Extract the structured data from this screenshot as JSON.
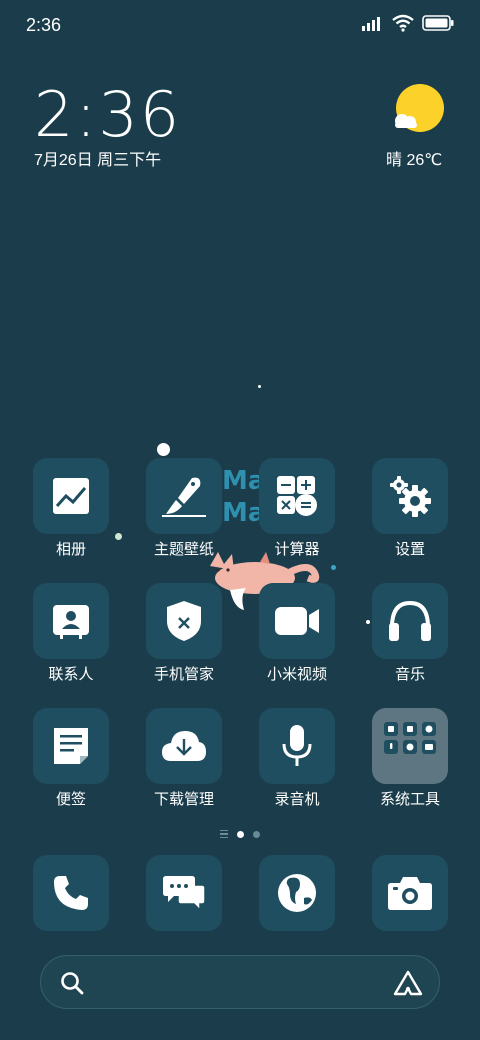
{
  "status_bar": {
    "time": "2:36",
    "icons": [
      "signal-icon",
      "wifi-icon",
      "battery-icon"
    ]
  },
  "clock_widget": {
    "time": "2:36",
    "date": "7月26日 周三下午"
  },
  "weather_widget": {
    "text": "晴 26℃",
    "icon": "sunny-icon",
    "sun_color": "#fcd12a"
  },
  "wallpaper": {
    "text_line1": "Mac",
    "text_line2": "Mac"
  },
  "apps": [
    {
      "label": "相册",
      "icon": "gallery-icon"
    },
    {
      "label": "主题壁纸",
      "icon": "theme-brush-icon"
    },
    {
      "label": "计算器",
      "icon": "calculator-icon"
    },
    {
      "label": "设置",
      "icon": "settings-gear-icon"
    },
    {
      "label": "联系人",
      "icon": "contacts-icon"
    },
    {
      "label": "手机管家",
      "icon": "security-shield-icon"
    },
    {
      "label": "小米视频",
      "icon": "video-camera-icon"
    },
    {
      "label": "音乐",
      "icon": "headphones-icon"
    },
    {
      "label": "便签",
      "icon": "notes-icon"
    },
    {
      "label": "下载管理",
      "icon": "download-cloud-icon"
    },
    {
      "label": "录音机",
      "icon": "microphone-icon"
    },
    {
      "label": "系统工具",
      "icon": "folder-icon"
    }
  ],
  "pager": {
    "pages": 2,
    "active": 1
  },
  "dock": [
    {
      "icon": "phone-icon"
    },
    {
      "icon": "messages-icon"
    },
    {
      "icon": "browser-icon"
    },
    {
      "icon": "camera-icon"
    }
  ],
  "search_bar": {
    "icon": "search-icon",
    "assistant_icon": "assistant-icon"
  }
}
